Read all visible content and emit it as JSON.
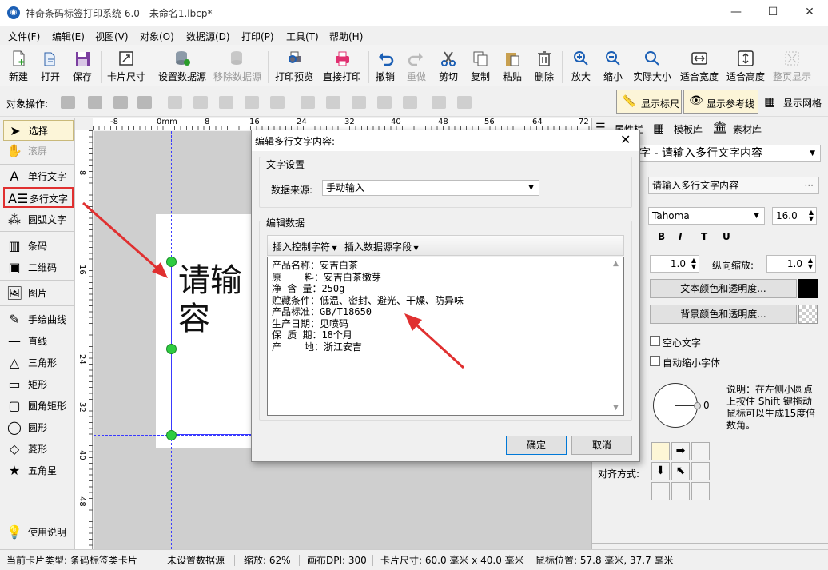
{
  "window": {
    "title": "神奇条码标签打印系统 6.0 - 未命名1.lbcp*"
  },
  "menu": [
    "文件(F)",
    "编辑(E)",
    "视图(V)",
    "对象(O)",
    "数据源(D)",
    "打印(P)",
    "工具(T)",
    "帮助(H)"
  ],
  "toolbar": {
    "new": "新建",
    "open": "打开",
    "save": "保存",
    "card_size": "卡片尺寸",
    "set_ds": "设置数据源",
    "remove_ds": "移除数据源",
    "preview": "打印预览",
    "print": "直接打印",
    "undo": "撤销",
    "redo": "重做",
    "cut": "剪切",
    "copy": "复制",
    "paste": "粘贴",
    "delete": "删除",
    "zoom_in": "放大",
    "zoom_out": "缩小",
    "actual": "实际大小",
    "fit_width": "适合宽度",
    "fit_height": "适合高度",
    "fit_page": "整页显示"
  },
  "objbar": {
    "label": "对象操作:",
    "show_ruler": "显示标尺",
    "show_guides": "显示参考线",
    "show_grid": "显示网格"
  },
  "tools": {
    "select": "选择",
    "scroll": "滚屏",
    "single_text": "单行文字",
    "multi_text": "多行文字",
    "arc_text": "圆弧文字",
    "barcode": "条码",
    "qrcode": "二维码",
    "image": "图片",
    "freehand": "手绘曲线",
    "line": "直线",
    "triangle": "三角形",
    "rect": "矩形",
    "round_rect": "圆角矩形",
    "circle": "圆形",
    "diamond": "菱形",
    "star": "五角星",
    "help": "使用说明"
  },
  "ruler": {
    "h_marks": [
      "-8",
      "0mm",
      "8",
      "16",
      "24",
      "32",
      "40",
      "48",
      "56",
      "64",
      "72"
    ],
    "v_marks": [
      "8",
      "16",
      "24",
      "32",
      "40",
      "48"
    ]
  },
  "card_text": [
    "请输",
    "容"
  ],
  "right_tabs": {
    "props": "属性栏",
    "templates": "模板库",
    "materials": "素材库"
  },
  "right": {
    "object_select": "字 - 请输入多行文字内容",
    "content_value": "请输入多行文字内容",
    "font": "Tahoma",
    "font_size": "16.0",
    "bold": "B",
    "italic": "I",
    "strike": "T",
    "underline": "U",
    "h_scale": "1.0",
    "v_scale_label": "纵向缩放:",
    "v_scale": "1.0",
    "text_color_btn": "文本颜色和透明度...",
    "bg_color_btn": "背景颜色和透明度...",
    "hollow": "空心文字",
    "auto_shrink": "自动缩小字体",
    "rotation": "0",
    "rotation_hint": "说明：在左侧小圆点上按住 Shift 键拖动鼠标可以生成15度倍数角。",
    "align_label": "对齐方式:"
  },
  "dialog": {
    "title": "编辑多行文字内容:",
    "text_settings": "文字设置",
    "ds_label": "数据来源:",
    "ds_value": "手动输入",
    "edit_data": "编辑数据",
    "insert_ctrl": "插入控制字符",
    "insert_field": "插入数据源字段",
    "content": "产品名称：安吉白茶\n原    料：安吉白茶嫩芽\n净 含 量：250g\n贮藏条件：低温、密封、避光、干燥、防异味\n产品标准：GB/T18650\n生产日期：见喷码\n保 质 期：18个月\n产    地：浙江安吉",
    "ok": "确定",
    "cancel": "取消"
  },
  "status": {
    "card_type": "当前卡片类型: 条码标签类卡片",
    "ds": "未设置数据源",
    "zoom": "缩放: 62%",
    "dpi": "画布DPI: 300",
    "card_size": "卡片尺寸: 60.0 毫米 x 40.0 毫米",
    "mouse": "鼠标位置: 57.8 毫米, 37.7 毫米"
  },
  "colors": {
    "accent": "#e03030",
    "guide": "#3a3aff",
    "handle": "#2ecc40"
  }
}
